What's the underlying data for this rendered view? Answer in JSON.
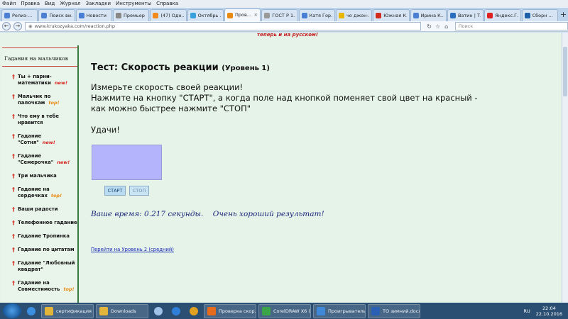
{
  "menu": [
    "Файл",
    "Правка",
    "Вид",
    "Журнал",
    "Закладки",
    "Инструменты",
    "Справка"
  ],
  "tabs": [
    {
      "label": "Релиз-...",
      "color": "#4a7fd3"
    },
    {
      "label": "Поиск ви...",
      "color": "#4a7fd3"
    },
    {
      "label": "Новости",
      "color": "#4a7fd3"
    },
    {
      "label": "Премьер Sta...",
      "color": "#888888"
    },
    {
      "label": "(47) Одн...",
      "color": "#f28b1e"
    },
    {
      "label": "Октябрь ...",
      "color": "#3aa0d9"
    },
    {
      "label": "Пров...",
      "color": "#e88a12"
    },
    {
      "label": "ГОСТ Р 1...",
      "color": "#999999"
    },
    {
      "label": "Катя Гор...",
      "color": "#4a7fd3"
    },
    {
      "label": "чо джон-...",
      "color": "#e6b800"
    },
    {
      "label": "Южная К...",
      "color": "#d12a1f"
    },
    {
      "label": "Ирина К...",
      "color": "#4a7fd3"
    },
    {
      "label": "Ватин | Т...",
      "color": "#2a6fbf"
    },
    {
      "label": "Яндекс.Г...",
      "color": "#e02020"
    },
    {
      "label": "Сборн ...",
      "color": "#1e5fa8"
    }
  ],
  "active_tab_index": 6,
  "address": {
    "url": "www.krukozyaka.com/reaction.php"
  },
  "search": {
    "placeholder": "Поиск"
  },
  "page": {
    "top_note": "теперь и на русском!",
    "sidebar": {
      "header": "Гадания на мальчиков",
      "items": [
        {
          "label": "Ты + парни-математики",
          "badge": "new!",
          "badge_type": "new"
        },
        {
          "label": "Мальчик по палочкам",
          "badge": "top!",
          "badge_type": "top"
        },
        {
          "label": "Что ему в тебе нравится",
          "badge": "",
          "badge_type": ""
        },
        {
          "label": "Гадание \"Сотня\"",
          "badge": "new!",
          "badge_type": "new"
        },
        {
          "label": "Гадание \"Семерочка\"",
          "badge": "new!",
          "badge_type": "new"
        },
        {
          "label": "Три мальчика",
          "badge": "",
          "badge_type": ""
        },
        {
          "label": "Гадание на сердечках",
          "badge": "top!",
          "badge_type": "top"
        },
        {
          "label": "Ваши радости",
          "badge": "",
          "badge_type": ""
        },
        {
          "label": "Телефонное гадание",
          "badge": "",
          "badge_type": ""
        },
        {
          "label": "Гадание Тропинка",
          "badge": "",
          "badge_type": ""
        },
        {
          "label": "Гадание по цитатам",
          "badge": "",
          "badge_type": ""
        },
        {
          "label": "Гадание \"Любовный квадрат\"",
          "badge": "",
          "badge_type": ""
        },
        {
          "label": "Гадание на Совместимость",
          "badge": "top!",
          "badge_type": "top"
        }
      ]
    },
    "test": {
      "title": "Тест: Скорость реакции",
      "level": "(Уровень 1)",
      "instructions_line1": "Измерьте скорость своей реакции!",
      "instructions_line2": "Нажмите на кнопку \"СТАРТ\", а когда поле над кнопкой поменяет свой цвет на красный - как можно быстрее нажмите \"СТОП\"",
      "luck": "Удачи!",
      "field_color": "#b4b4fd",
      "start_label": "СТАРТ",
      "stop_label": "СТОП",
      "result": "Ваше время: 0.217 секунды.    Очень хороший результат!",
      "next_link": "Перейти на Уровень 2 (средний)"
    }
  },
  "taskbar": {
    "apps": [
      {
        "label": "сертификация",
        "color": "#e3b53a"
      },
      {
        "label": "Downloads",
        "color": "#e3b53a"
      },
      {
        "label": "Проверка скор...",
        "color": "#e66b1d"
      },
      {
        "label": "CorelDRAW X6 (...",
        "color": "#3aa648"
      },
      {
        "label": "Проигрыватель...",
        "color": "#3f88d8"
      },
      {
        "label": "ТО зимний.docx...",
        "color": "#2b5fb3"
      }
    ],
    "pins": [
      {
        "name": "ie-icon",
        "color": "#3b8ee0"
      },
      {
        "name": "volume-icon",
        "color": "#9fc3e8"
      },
      {
        "name": "bluetooth-icon",
        "color": "#2f7fd8"
      },
      {
        "name": "chrome-icon",
        "color": "#e0a020"
      }
    ],
    "lang": "RU",
    "time": "22:04",
    "date": "22.10.2016"
  }
}
